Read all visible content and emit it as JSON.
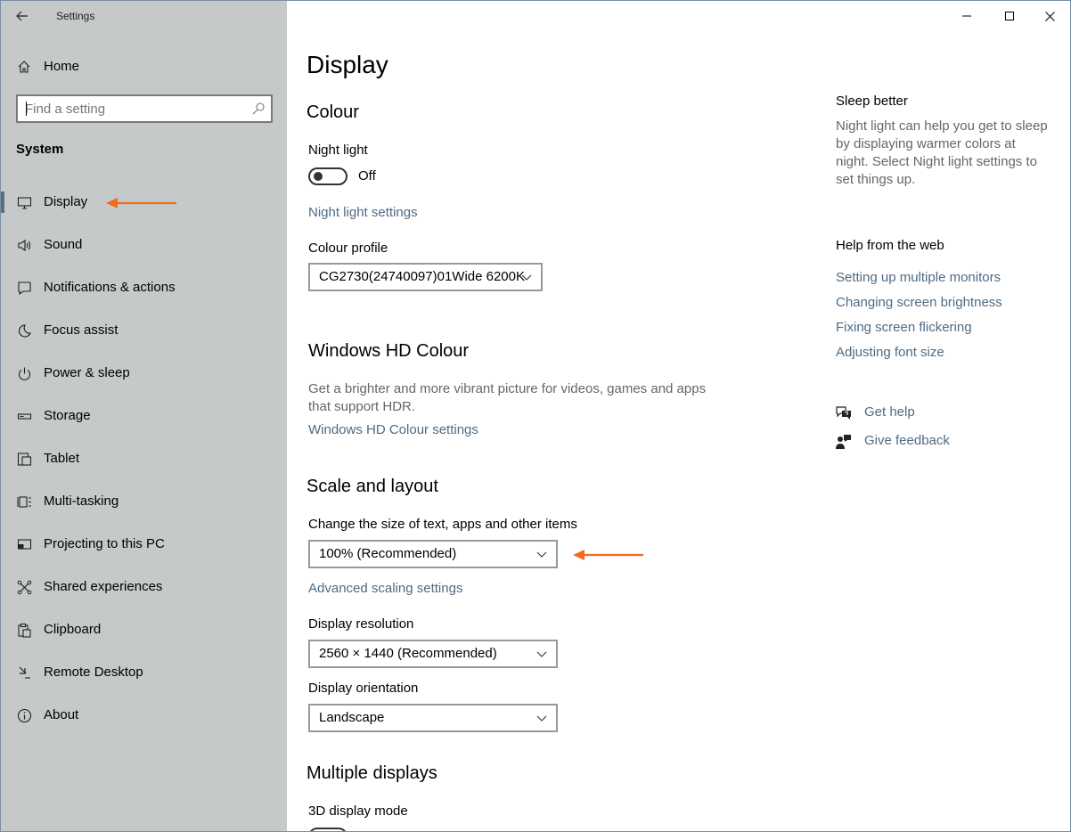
{
  "window": {
    "title": "Settings",
    "controls": {
      "minimize_icon": "minimize-icon",
      "maximize_icon": "maximize-icon",
      "close_icon": "close-icon"
    }
  },
  "sidebar": {
    "home": {
      "label": "Home",
      "icon": "home-icon"
    },
    "search": {
      "placeholder": "Find a setting",
      "icon": "search-icon"
    },
    "section": "System",
    "items": [
      {
        "label": "Display",
        "icon": "monitor-icon",
        "active": true
      },
      {
        "label": "Sound",
        "icon": "speaker-icon"
      },
      {
        "label": "Notifications & actions",
        "icon": "notification-icon"
      },
      {
        "label": "Focus assist",
        "icon": "moon-icon"
      },
      {
        "label": "Power & sleep",
        "icon": "power-icon"
      },
      {
        "label": "Storage",
        "icon": "storage-icon"
      },
      {
        "label": "Tablet",
        "icon": "tablet-icon"
      },
      {
        "label": "Multi-tasking",
        "icon": "multitasking-icon"
      },
      {
        "label": "Projecting to this PC",
        "icon": "projecting-icon"
      },
      {
        "label": "Shared experiences",
        "icon": "shared-experiences-icon"
      },
      {
        "label": "Clipboard",
        "icon": "clipboard-icon"
      },
      {
        "label": "Remote Desktop",
        "icon": "remote-desktop-icon"
      },
      {
        "label": "About",
        "icon": "info-icon"
      }
    ]
  },
  "main": {
    "title": "Display",
    "colour": {
      "heading": "Colour",
      "night_light_label": "Night light",
      "night_light_state": "Off",
      "night_light_settings_link": "Night light settings",
      "colour_profile_label": "Colour profile",
      "colour_profile_value": "CG2730(24740097)01Wide 6200K"
    },
    "hd_colour": {
      "heading": "Windows HD Colour",
      "description": "Get a brighter and more vibrant picture for videos, games and apps that support HDR.",
      "settings_link": "Windows HD Colour settings"
    },
    "scale_layout": {
      "heading": "Scale and layout",
      "size_label": "Change the size of text, apps and other items",
      "size_value": "100% (Recommended)",
      "advanced_link": "Advanced scaling settings",
      "resolution_label": "Display resolution",
      "resolution_value": "2560 × 1440 (Recommended)",
      "orientation_label": "Display orientation",
      "orientation_value": "Landscape"
    },
    "multiple_displays": {
      "heading": "Multiple displays",
      "mode_label": "3D display mode"
    }
  },
  "right": {
    "sleep_heading": "Sleep better",
    "sleep_text": "Night light can help you get to sleep by displaying warmer colors at night. Select Night light settings to set things up.",
    "help_heading": "Help from the web",
    "help_links": [
      "Setting up multiple monitors",
      "Changing screen brightness",
      "Fixing screen flickering",
      "Adjusting font size"
    ],
    "get_help": {
      "label": "Get help",
      "icon": "chat-help-icon"
    },
    "give_feedback": {
      "label": "Give feedback",
      "icon": "feedback-icon"
    }
  },
  "colors": {
    "sidebar_bg": "#c6c9c9",
    "link": "#4f6b83",
    "annotation_arrow": "#f26b1d"
  }
}
